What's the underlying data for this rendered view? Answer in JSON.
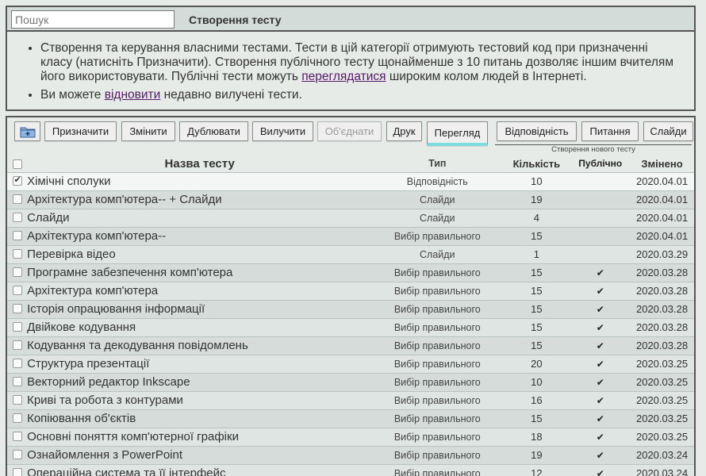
{
  "header": {
    "search_placeholder": "Пошук",
    "title": "Створення тесту"
  },
  "info": {
    "bullet1_text": "Створення та керування власними тестами. Тести в цій категорії отримують тестовий код при призначенні класу (натисніть Призначити). Створення публічного тесту щонайменше з 10 питань дозволяє іншим вчителям його використовувати. Публічні тести можуть",
    "bullet1_link": "переглядатися",
    "bullet1_tail": "широким колом людей в Інтернеті.",
    "bullet2_text": "Ви можете",
    "bullet2_link": "відновити",
    "bullet2_tail": "недавно вилучені тести."
  },
  "toolbar": {
    "folder_icon": "new-folder-icon",
    "assign": "Призначити",
    "edit": "Змінити",
    "duplicate": "Дублювати",
    "delete": "Вилучити",
    "merge": "Об'єднати",
    "print": "Друк",
    "preview": "Перегляд",
    "matching": "Відповідність",
    "questions": "Питання",
    "slides": "Слайди",
    "new_test_hint": "Створення нового тесту"
  },
  "table": {
    "headers": {
      "name": "Назва тесту",
      "type": "Тип",
      "count": "Кількість",
      "public": "Публічно",
      "modified": "Змінено"
    },
    "rows": [
      {
        "name": "Хімічні сполуки",
        "type": "Відповідність",
        "count": "10",
        "public": "",
        "date": "2020.04.01"
      },
      {
        "name": "Архітектура комп'ютера-- + Слайди",
        "type": "Слайди",
        "count": "19",
        "public": "",
        "date": "2020.04.01"
      },
      {
        "name": "Слайди",
        "type": "Слайди",
        "count": "4",
        "public": "",
        "date": "2020.04.01"
      },
      {
        "name": "Архітектура комп'ютера--",
        "type": "Вибір правильного",
        "count": "15",
        "public": "",
        "date": "2020.04.01"
      },
      {
        "name": "Перевірка відео",
        "type": "Слайди",
        "count": "1",
        "public": "",
        "date": "2020.03.29"
      },
      {
        "name": "Програмне забезпечення комп'ютера",
        "type": "Вибір правильного",
        "count": "15",
        "public": "✔",
        "date": "2020.03.28"
      },
      {
        "name": "Архітектура комп'ютера",
        "type": "Вибір правильного",
        "count": "15",
        "public": "✔",
        "date": "2020.03.28"
      },
      {
        "name": "Історія опрацювання інформації",
        "type": "Вибір правильного",
        "count": "15",
        "public": "✔",
        "date": "2020.03.28"
      },
      {
        "name": "Двійкове кодування",
        "type": "Вибір правильного",
        "count": "15",
        "public": "✔",
        "date": "2020.03.28"
      },
      {
        "name": "Кодування та декодування повідомлень",
        "type": "Вибір правильного",
        "count": "15",
        "public": "✔",
        "date": "2020.03.28"
      },
      {
        "name": "Структура презентації",
        "type": "Вибір правильного",
        "count": "20",
        "public": "✔",
        "date": "2020.03.25"
      },
      {
        "name": "Векторний редактор Inkscape",
        "type": "Вибір правильного",
        "count": "10",
        "public": "✔",
        "date": "2020.03.25"
      },
      {
        "name": "Криві та робота з контурами",
        "type": "Вибір правильного",
        "count": "16",
        "public": "✔",
        "date": "2020.03.25"
      },
      {
        "name": "Копіювання об'єктів",
        "type": "Вибір правильного",
        "count": "15",
        "public": "✔",
        "date": "2020.03.25"
      },
      {
        "name": "Основні поняття комп'ютерної графіки",
        "type": "Вибір правильного",
        "count": "18",
        "public": "✔",
        "date": "2020.03.25"
      },
      {
        "name": "Ознайомлення з PowerPoint",
        "type": "Вибір правильного",
        "count": "19",
        "public": "✔",
        "date": "2020.03.24"
      },
      {
        "name": "Операційна система та її інтерфейс",
        "type": "Вибір правильного",
        "count": "12",
        "public": "✔",
        "date": "2020.03.24"
      }
    ]
  }
}
